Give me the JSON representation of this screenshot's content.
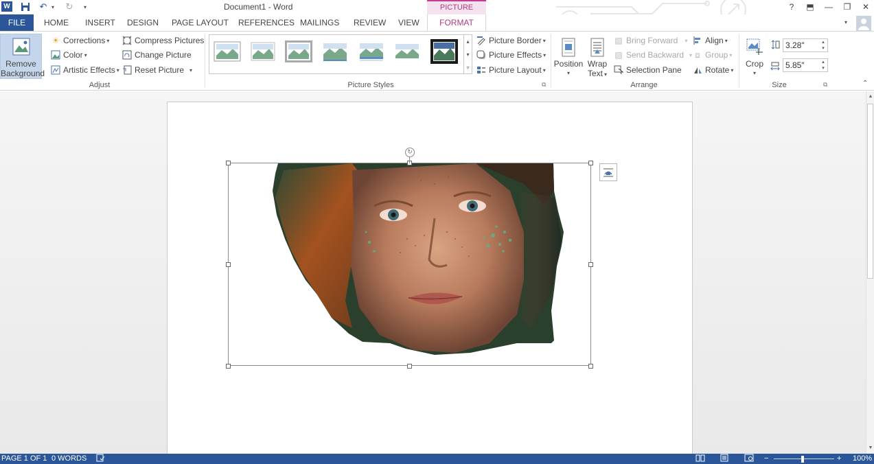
{
  "window": {
    "title": "Document1 - Word",
    "context_tab_group": "PICTURE TOOLS",
    "help_glyph": "?",
    "ribbon_display_glyph": "⬒",
    "minimize_glyph": "—",
    "restore_glyph": "❐",
    "close_glyph": "✕"
  },
  "quick_access": {
    "app_logo": "W",
    "save_glyph": "💾",
    "undo_glyph": "↶",
    "redo_glyph": "↻",
    "customize_glyph": "▾"
  },
  "tabs": [
    "FILE",
    "HOME",
    "INSERT",
    "DESIGN",
    "PAGE LAYOUT",
    "REFERENCES",
    "MAILINGS",
    "REVIEW",
    "VIEW",
    "FORMAT"
  ],
  "ribbon": {
    "adjust": {
      "label": "Adjust",
      "remove_background_line1": "Remove",
      "remove_background_line2": "Background",
      "corrections": "Corrections",
      "color": "Color",
      "artistic_effects": "Artistic Effects",
      "compress_pictures": "Compress Pictures",
      "change_picture": "Change Picture",
      "reset_picture": "Reset Picture"
    },
    "picture_styles": {
      "label": "Picture Styles",
      "picture_border": "Picture Border",
      "picture_effects": "Picture Effects",
      "picture_layout": "Picture Layout"
    },
    "arrange": {
      "label": "Arrange",
      "position": "Position",
      "wrap_text_line1": "Wrap",
      "wrap_text_line2": "Text",
      "bring_forward": "Bring Forward",
      "send_backward": "Send Backward",
      "selection_pane": "Selection Pane",
      "align": "Align",
      "group": "Group",
      "rotate": "Rotate"
    },
    "size": {
      "label": "Size",
      "crop": "Crop",
      "height": "3.28\"",
      "width": "5.85\""
    }
  },
  "statusbar": {
    "page": "PAGE 1 OF 1",
    "words": "0 WORDS",
    "zoom": "100%",
    "zoom_minus": "−",
    "zoom_plus": "+"
  },
  "colors": {
    "word_blue": "#2b579a",
    "picture_tools_pink": "#c43c8e",
    "selected_fill": "#c5d6ec"
  }
}
